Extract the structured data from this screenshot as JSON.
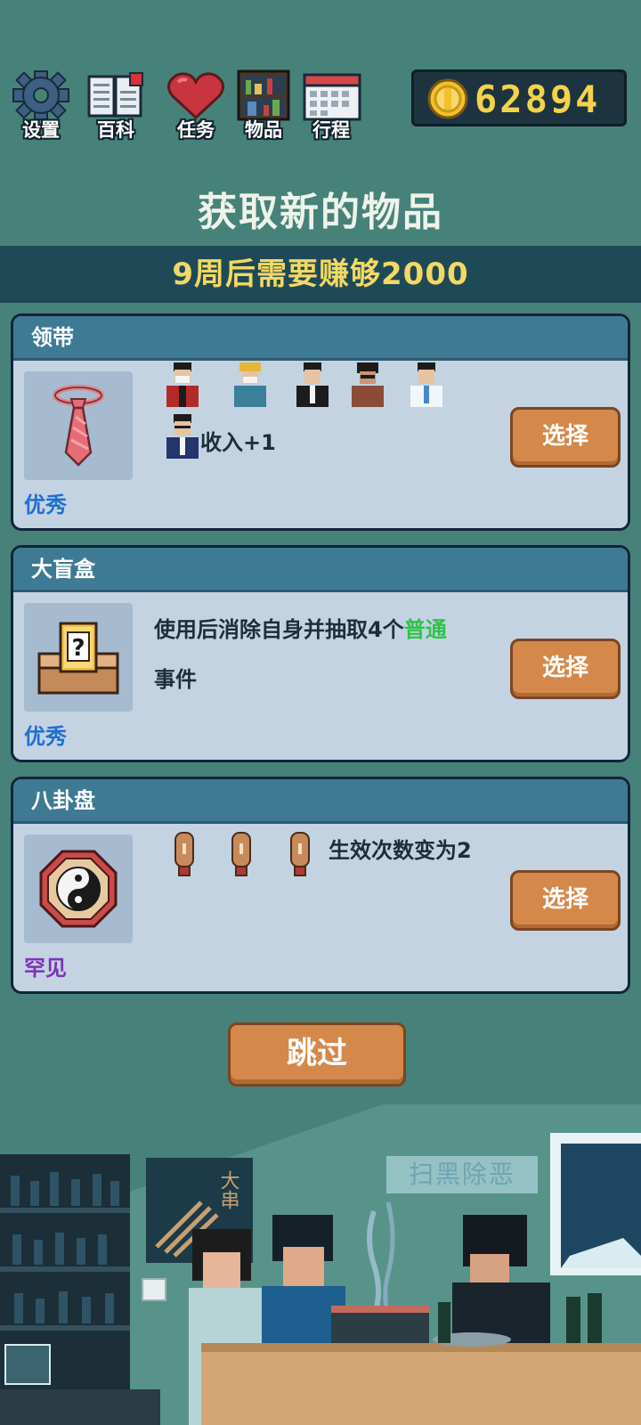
{
  "menu": [
    {
      "label": "设置",
      "icon": "gear-icon"
    },
    {
      "label": "百科",
      "icon": "book-icon"
    },
    {
      "label": "任务",
      "icon": "heart-icon"
    },
    {
      "label": "物品",
      "icon": "shelf-icon"
    },
    {
      "label": "行程",
      "icon": "calendar-icon"
    }
  ],
  "coins": "62894",
  "title": "获取新的物品",
  "goal": "9周后需要赚够2000",
  "cards": [
    {
      "name": "领带",
      "icon": "tie-icon",
      "rarity": "优秀",
      "rarity_color": "#1f6fd0",
      "effect": "收入+1",
      "choose_label": "选择"
    },
    {
      "name": "大盲盒",
      "icon": "blind-box-icon",
      "rarity": "优秀",
      "rarity_color": "#1f6fd0",
      "effect_line1": "使用后消除自身并抽取4个",
      "effect_highlight": "普通",
      "highlight_color": "#2fc24a",
      "effect_line2": "事件",
      "choose_label": "选择"
    },
    {
      "name": "八卦盘",
      "icon": "bagua-plate-icon",
      "rarity": "罕见",
      "rarity_color": "#7d34b8",
      "effect": "生效次数变为2",
      "choose_label": "选择"
    }
  ],
  "skip_label": "跳过",
  "scene": {
    "poster_text": "大串",
    "banner_text": "扫黑除恶"
  }
}
